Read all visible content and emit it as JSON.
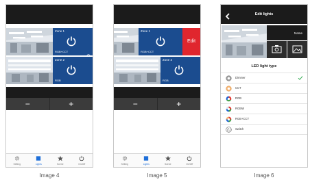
{
  "captions": [
    "Image 4",
    "Image 5",
    "Image 6"
  ],
  "zones": [
    {
      "name": "Zone 1",
      "type": "RGB+CCT"
    },
    {
      "name": "Zone 2",
      "type": "RGB"
    }
  ],
  "edit_button_label": "Edit",
  "controls": {
    "minus": "−",
    "plus": "+"
  },
  "nav": [
    {
      "label": "Setting",
      "icon": "gear-icon"
    },
    {
      "label": "Lights",
      "icon": "square-icon",
      "active": true
    },
    {
      "label": "Scene",
      "icon": "star-icon"
    },
    {
      "label": "On/Off",
      "icon": "power-icon"
    }
  ],
  "colors": {
    "accent": "#1e6fd9",
    "zone_blue": "#1b4c8f",
    "edit_red": "#e0262e",
    "check_green": "#2aa84a"
  },
  "edit_lights": {
    "title": "Edit lights",
    "name_label": "Name",
    "led_type_title": "LED light type",
    "types": [
      {
        "label": "Dimmer",
        "icon": "dimmer-icon",
        "selected": true
      },
      {
        "label": "CCT",
        "icon": "cct-icon"
      },
      {
        "label": "RGB",
        "icon": "rgb-icon"
      },
      {
        "label": "RGBW",
        "icon": "rgbw-icon"
      },
      {
        "label": "RGB+CCT",
        "icon": "rgbcct-icon"
      },
      {
        "label": "Switch",
        "icon": "switch-icon"
      }
    ]
  }
}
